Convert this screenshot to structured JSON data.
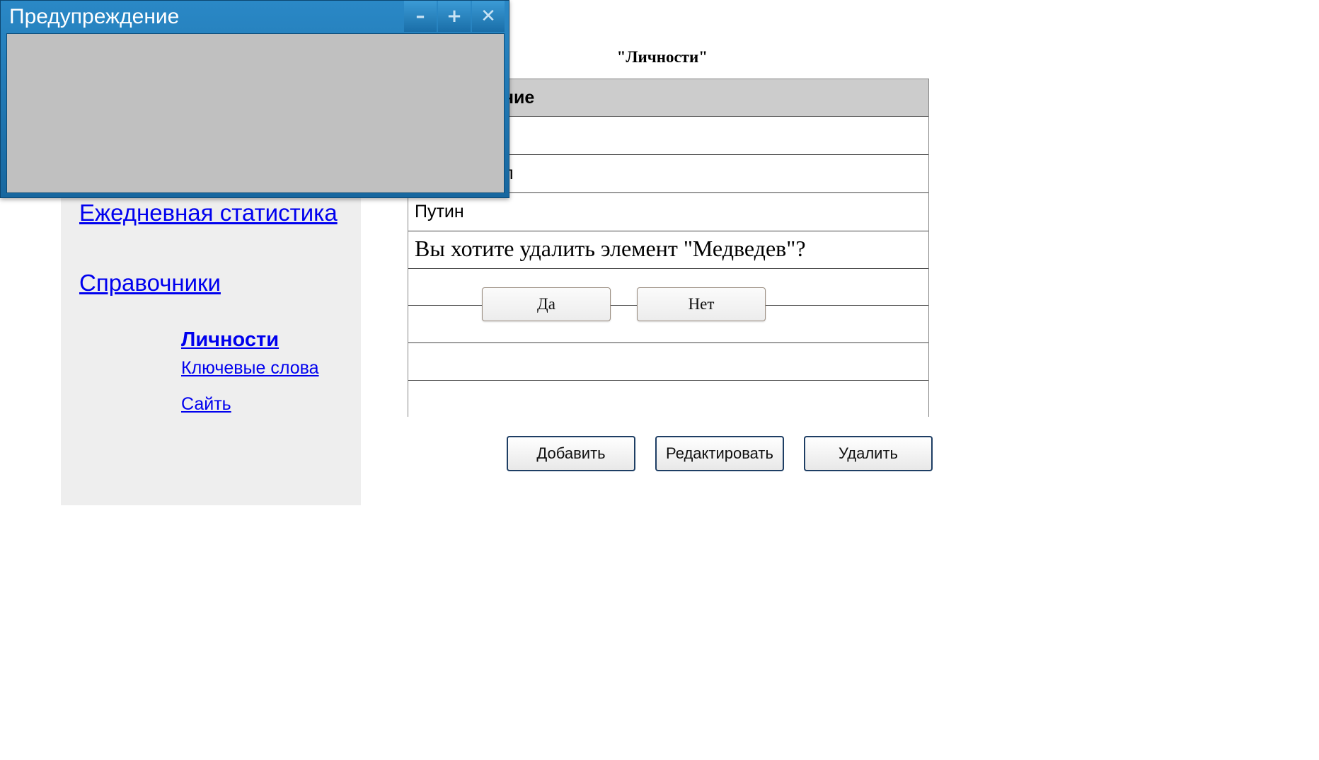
{
  "sidebar": {
    "daily_stats": "Ежедневная статистика",
    "directories": "Справочники",
    "persons": "Личности",
    "keywords": "Ключевые слова",
    "sites": "Сайть"
  },
  "section": {
    "heading": "\"Личности\""
  },
  "table": {
    "header": "ание",
    "rows": [
      "",
      "л",
      "Путин"
    ],
    "confirm_text": "Вы хотите удалить элемент \"Медведев\"?",
    "yes": "Да",
    "no": "Нет"
  },
  "actions": {
    "add": "Добавить",
    "edit": "Редактировать",
    "delete": "Удалить"
  },
  "modal": {
    "title": "Предупреждение",
    "minimize_icon": "minimize-icon",
    "maximize_icon": "plus-icon",
    "close_icon": "close-icon",
    "minimize_glyph": "–",
    "maximize_glyph": "+",
    "close_glyph": "✕"
  },
  "colors": {
    "modal_title_bar": "#1f76b3",
    "modal_body": "#c0c0c0",
    "link": "#0000ee",
    "sidebar_bg": "#eeeeee",
    "table_header_bg": "#cccccc",
    "action_border": "#1e3e64"
  }
}
